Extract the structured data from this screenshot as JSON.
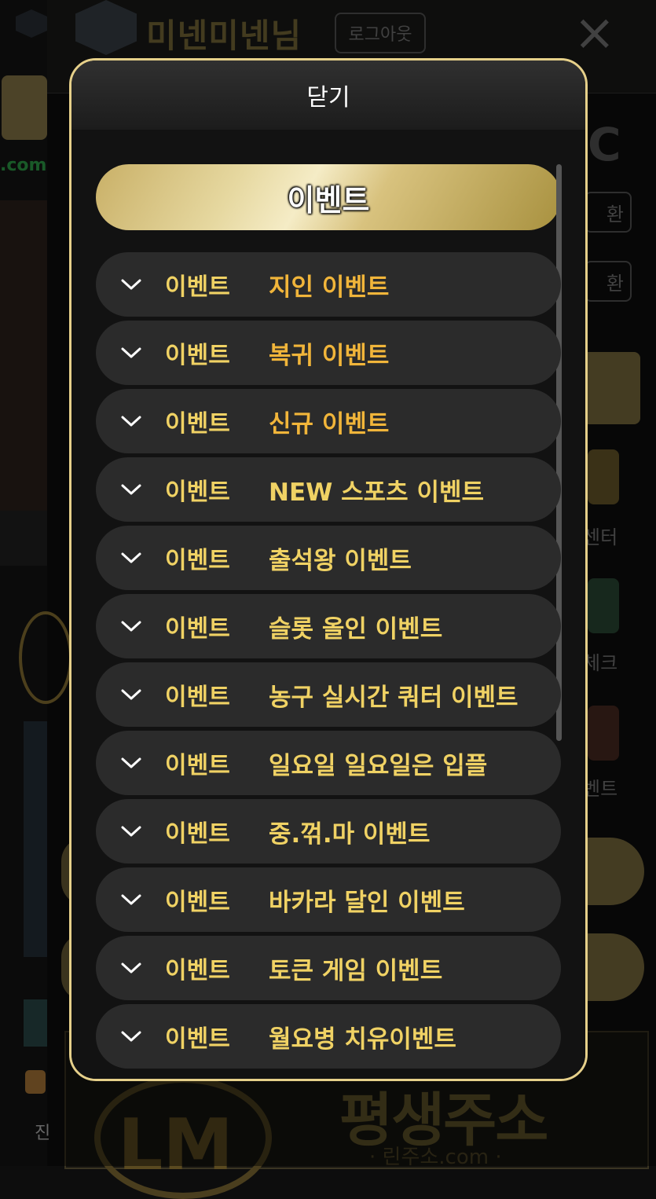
{
  "background": {
    "username": "미넨미넨님",
    "logout_label": "로그아웃",
    "close_glyph": "×",
    "left_domain_fragment": ".com",
    "right_convert_label_1": "환",
    "right_convert_label_2": "환",
    "right_label_center": "센터",
    "right_label_check": "체크",
    "right_label_event": "벤트",
    "left_label_jin": "진",
    "bottom_banner_text": "평생주소",
    "bottom_banner_sub": "· 린주소.com ·"
  },
  "modal": {
    "close_label": "닫기",
    "title": "이벤트",
    "items": [
      {
        "category": "이벤트",
        "name": "지인 이벤트"
      },
      {
        "category": "이벤트",
        "name": "복귀 이벤트"
      },
      {
        "category": "이벤트",
        "name": "신규 이벤트"
      },
      {
        "category": "이벤트",
        "name": "NEW 스포츠 이벤트"
      },
      {
        "category": "이벤트",
        "name": "출석왕 이벤트"
      },
      {
        "category": "이벤트",
        "name": "슬롯 올인 이벤트"
      },
      {
        "category": "이벤트",
        "name": "농구 실시간 쿼터 이벤트"
      },
      {
        "category": "이벤트",
        "name": "일요일 일요일은 입플"
      },
      {
        "category": "이벤트",
        "name": "중.꺾.마 이벤트"
      },
      {
        "category": "이벤트",
        "name": "바카라 달인 이벤트"
      },
      {
        "category": "이벤트",
        "name": "토큰 게임 이벤트"
      },
      {
        "category": "이벤트",
        "name": "월요병 치유이벤트"
      }
    ]
  },
  "colors": {
    "gold_border": "#e6d08a",
    "item_text": "#f0d264",
    "highlight_text": "#f1b53a",
    "item_bg": "#2b2b2b"
  }
}
